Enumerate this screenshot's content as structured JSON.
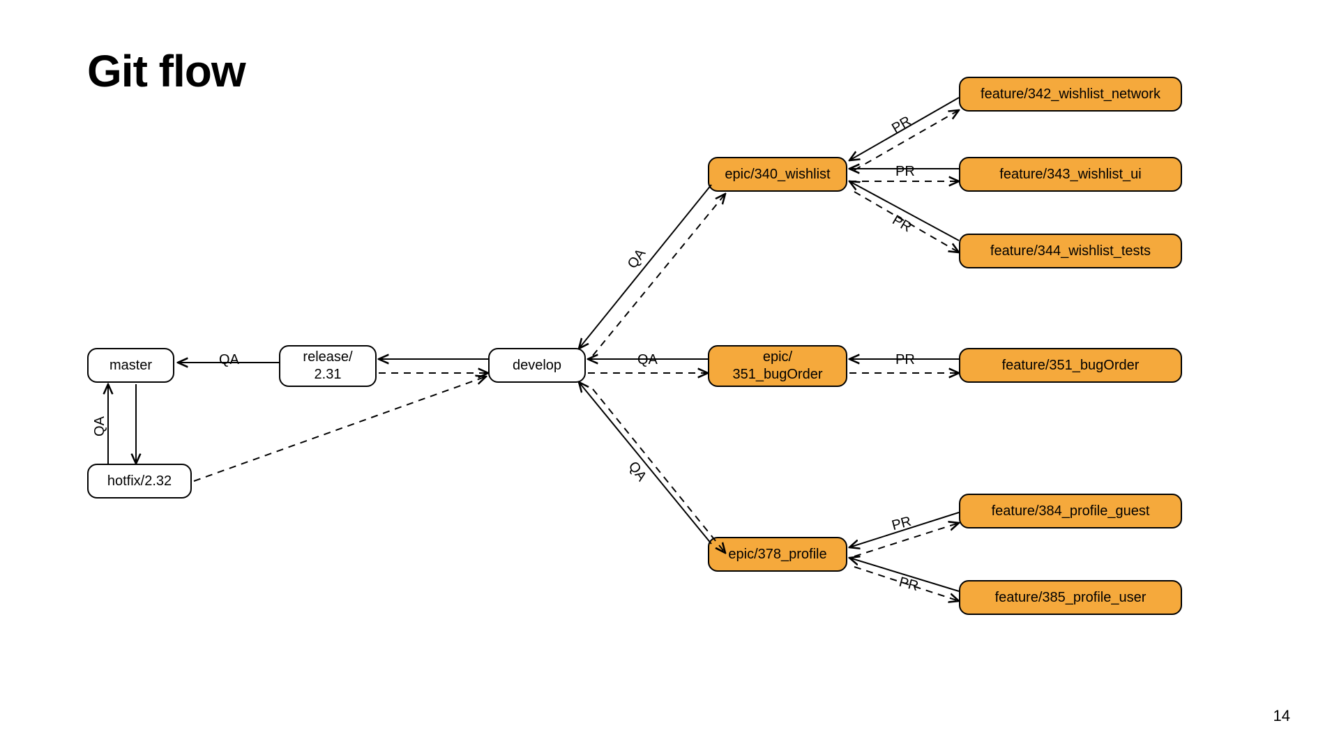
{
  "title": "Git flow",
  "page_number": "14",
  "nodes": {
    "master": "master",
    "hotfix": "hotfix/2.32",
    "release": "release/\n2.31",
    "develop": "develop",
    "epic_wishlist": "epic/340_wishlist",
    "epic_bugorder": "epic/\n351_bugOrder",
    "epic_profile": "epic/378_profile",
    "feat_342": "feature/342_wishlist_network",
    "feat_343": "feature/343_wishlist_ui",
    "feat_344": "feature/344_wishlist_tests",
    "feat_351": "feature/351_bugOrder",
    "feat_384": "feature/384_profile_guest",
    "feat_385": "feature/385_profile_user"
  },
  "labels": {
    "qa": "QA",
    "pr": "PR"
  }
}
